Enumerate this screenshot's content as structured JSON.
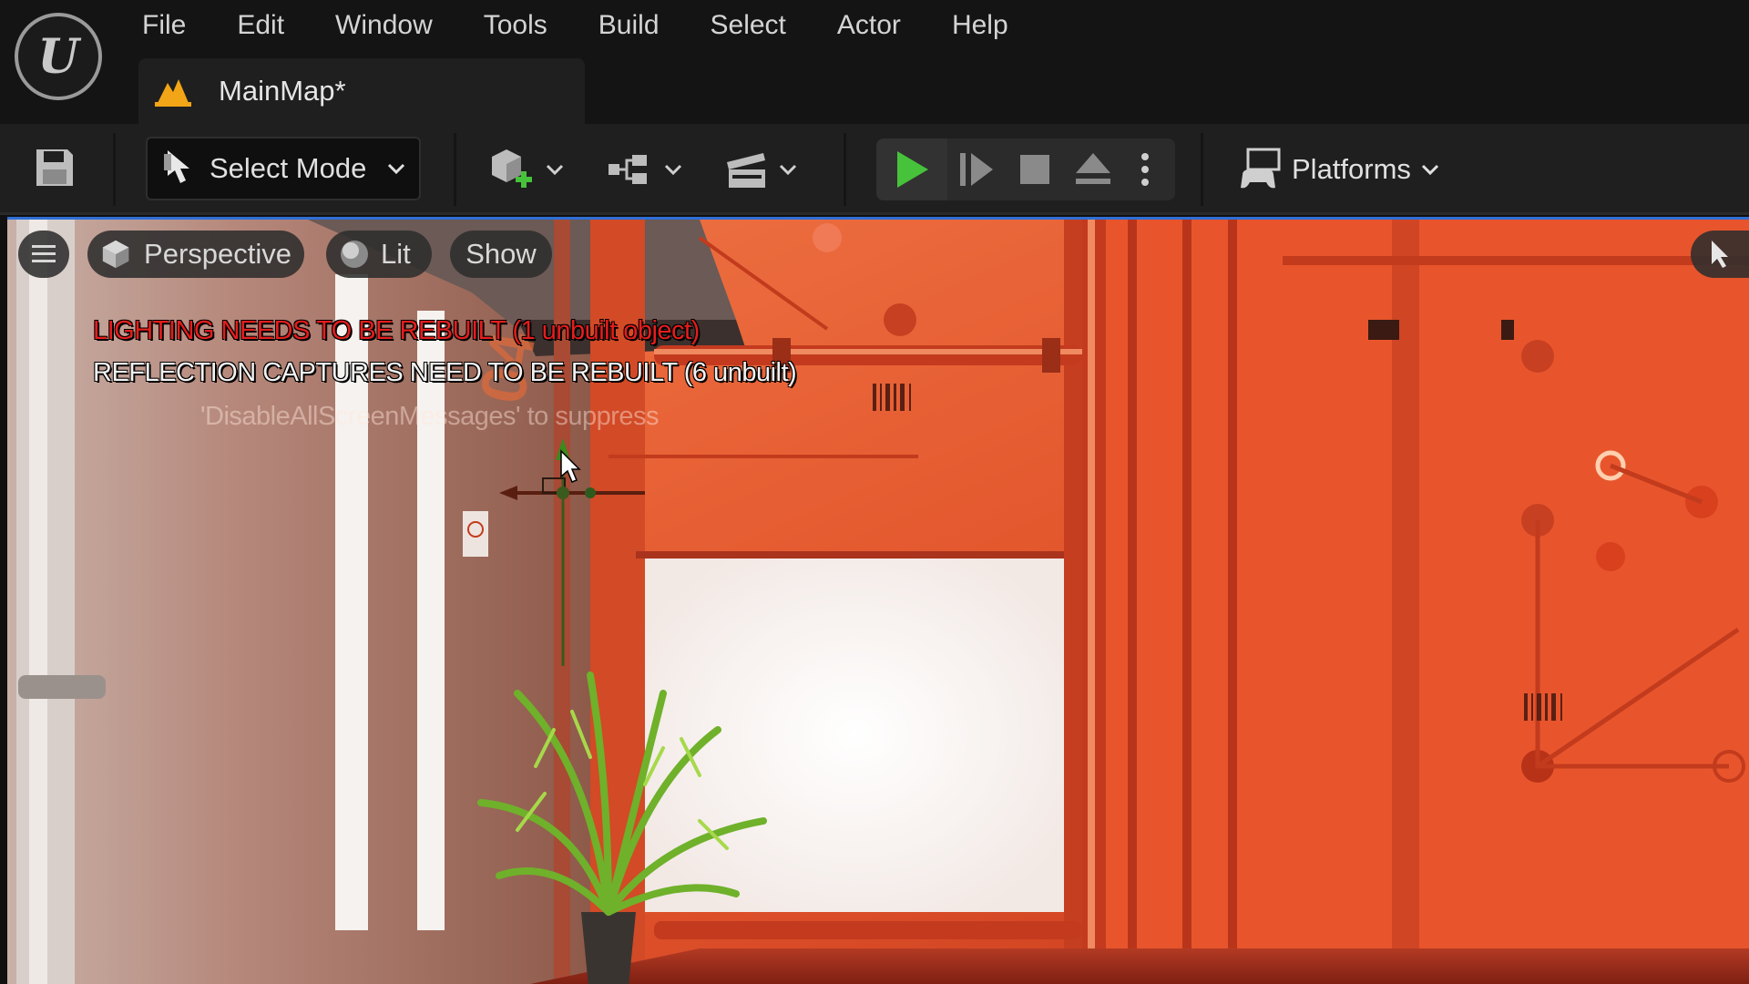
{
  "menu": [
    "File",
    "Edit",
    "Window",
    "Tools",
    "Build",
    "Select",
    "Actor",
    "Help"
  ],
  "tab": {
    "title": "MainMap*",
    "icon": "level-icon"
  },
  "toolbar": {
    "mode_label": "Select Mode",
    "platforms_label": "Platforms"
  },
  "viewport": {
    "menu_icon": "hamburger-icon",
    "perspective_label": "Perspective",
    "lit_label": "Lit",
    "show_label": "Show",
    "messages": {
      "lighting": "LIGHTING NEEDS TO BE REBUILT (1 unbuilt object)",
      "reflection": "REFLECTION CAPTURES NEED TO BE REBUILT (6 unbuilt)",
      "suppress": "'DisableAllScreenMessages' to suppress"
    }
  },
  "colors": {
    "accent_blue": "#2f6fd6",
    "play_green": "#47c23b",
    "warning_red": "#e51d1d",
    "scene_orange": "#d9582e"
  }
}
